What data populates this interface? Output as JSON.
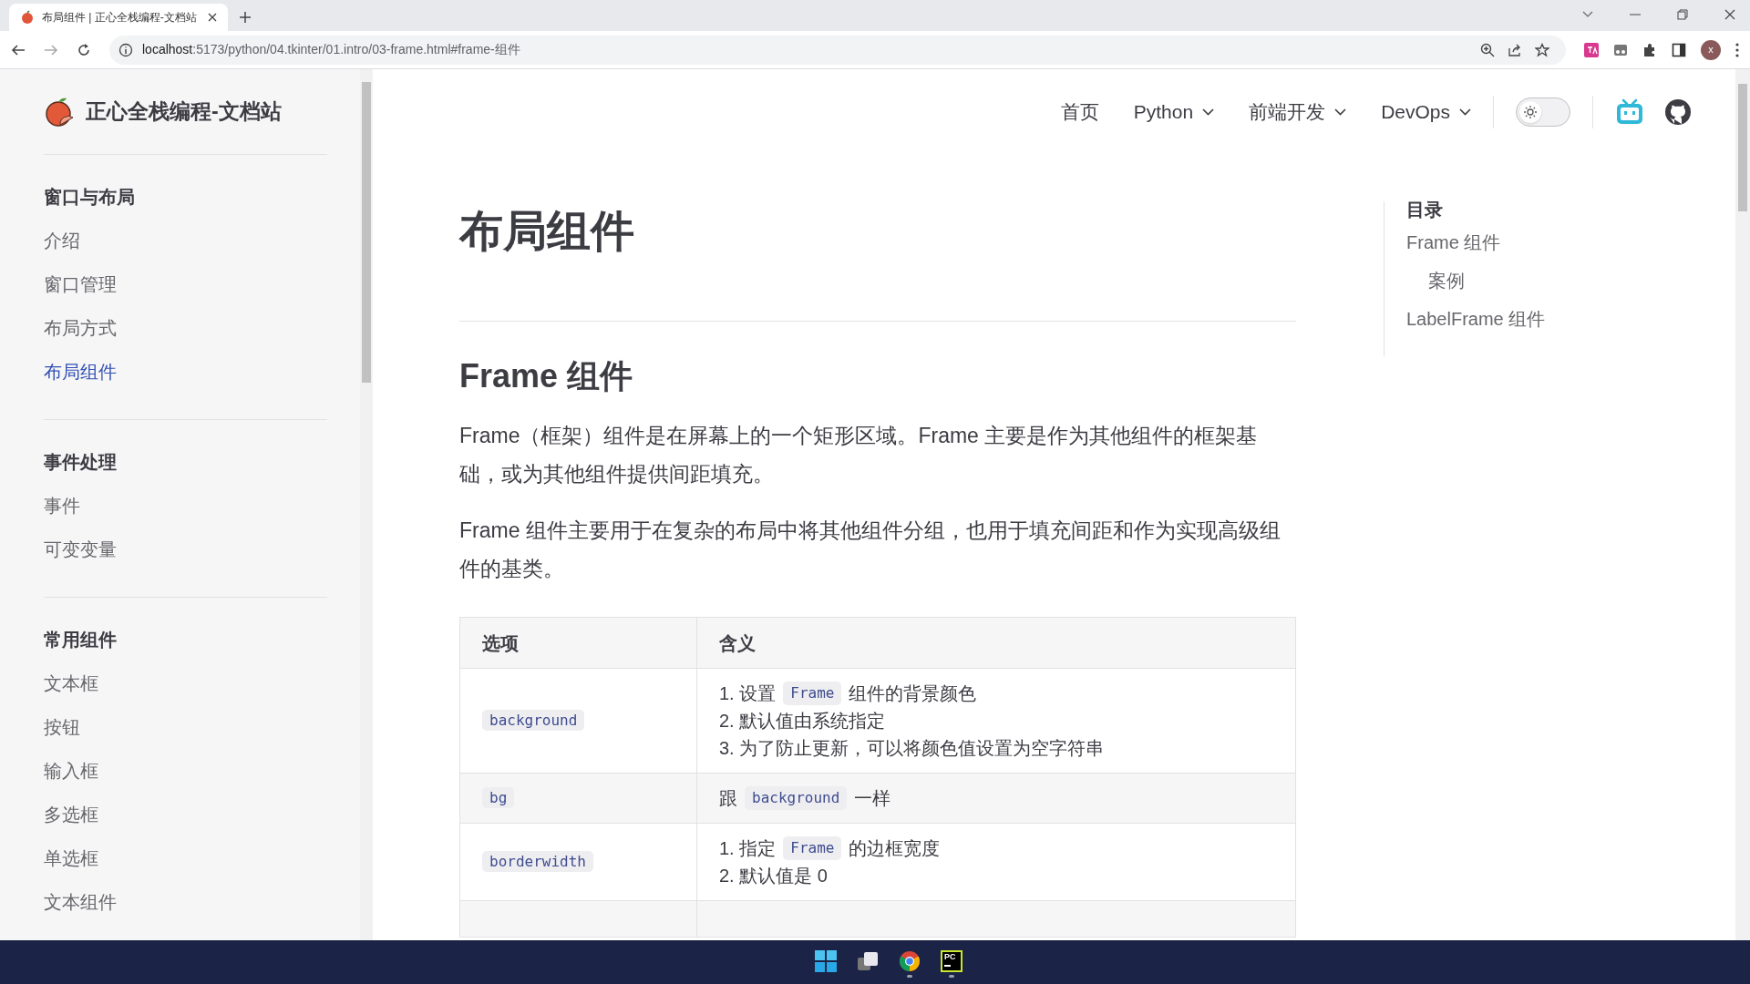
{
  "browser": {
    "tab_title": "布局组件 | 正心全栈编程-文档站",
    "url_host": "localhost",
    "url_rest": ":5173/python/04.tkinter/01.intro/03-frame.html#frame-组件",
    "avatar": "x"
  },
  "sidebar": {
    "site_title": "正心全栈编程-文档站",
    "groups": [
      {
        "title": "窗口与布局",
        "items": [
          {
            "label": "介绍",
            "selected": false
          },
          {
            "label": "窗口管理",
            "selected": false
          },
          {
            "label": "布局方式",
            "selected": false
          },
          {
            "label": "布局组件",
            "selected": true
          }
        ]
      },
      {
        "title": "事件处理",
        "items": [
          {
            "label": "事件",
            "selected": false
          },
          {
            "label": "可变变量",
            "selected": false
          }
        ]
      },
      {
        "title": "常用组件",
        "items": [
          {
            "label": "文本框",
            "selected": false
          },
          {
            "label": "按钮",
            "selected": false
          },
          {
            "label": "输入框",
            "selected": false
          },
          {
            "label": "多选框",
            "selected": false
          },
          {
            "label": "单选框",
            "selected": false
          },
          {
            "label": "文本组件",
            "selected": false
          }
        ]
      }
    ]
  },
  "nav": {
    "items": [
      {
        "label": "首页",
        "dropdown": false
      },
      {
        "label": "Python",
        "dropdown": true
      },
      {
        "label": "前端开发",
        "dropdown": true
      },
      {
        "label": "DevOps",
        "dropdown": true
      }
    ],
    "dark_mode": false
  },
  "content": {
    "title": "布局组件",
    "section": {
      "heading": "Frame 组件",
      "paragraphs": [
        "Frame（框架）组件是在屏幕上的一个矩形区域。Frame 主要是作为其他组件的框架基础，或为其他组件提供间距填充。",
        "Frame 组件主要用于在复杂的布局中将其他组件分组，也用于填充间距和作为实现高级组件的基类。"
      ],
      "table": {
        "columns": [
          "选项",
          "含义"
        ],
        "rows": [
          {
            "option": "background",
            "meaning": [
              [
                {
                  "kind": "text",
                  "text": "1. 设置"
                },
                {
                  "kind": "code",
                  "text": "Frame"
                },
                {
                  "kind": "text",
                  "text": "组件的背景颜色"
                }
              ],
              [
                {
                  "kind": "text",
                  "text": "2. 默认值由系统指定"
                }
              ],
              [
                {
                  "kind": "text",
                  "text": "3. 为了防止更新，可以将颜色值设置为空字符串"
                }
              ]
            ]
          },
          {
            "option": "bg",
            "meaning": [
              [
                {
                  "kind": "text",
                  "text": "跟"
                },
                {
                  "kind": "code",
                  "text": "background"
                },
                {
                  "kind": "text",
                  "text": "一样"
                }
              ]
            ]
          },
          {
            "option": "borderwidth",
            "meaning": [
              [
                {
                  "kind": "text",
                  "text": "1. 指定"
                },
                {
                  "kind": "code",
                  "text": "Frame"
                },
                {
                  "kind": "text",
                  "text": "的边框宽度"
                }
              ],
              [
                {
                  "kind": "text",
                  "text": "2. 默认值是 0"
                }
              ]
            ]
          }
        ]
      }
    }
  },
  "toc": {
    "title": "目录",
    "items": [
      {
        "label": "Frame 组件",
        "children": [
          {
            "label": "案例"
          }
        ]
      },
      {
        "label": "LabelFrame 组件"
      }
    ]
  },
  "taskbar": {
    "apps": [
      {
        "kind": "start"
      },
      {
        "kind": "taskview"
      },
      {
        "kind": "chrome"
      },
      {
        "kind": "pycharm",
        "label": "PC"
      }
    ]
  }
}
